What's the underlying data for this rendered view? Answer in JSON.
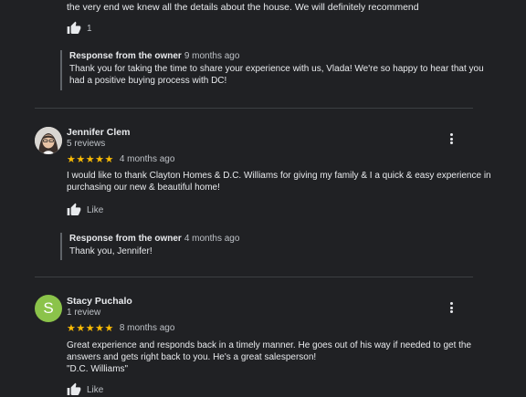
{
  "previous_review": {
    "text_tail": "the very end we knew all the details about the house. We will definitely recommend",
    "like_count": "1",
    "response": {
      "title": "Response from the owner",
      "time": "9 months ago",
      "text": "Thank you for taking the time to share your experience with us, Vlada! We're so happy to hear that you had a positive buying process with DC!"
    }
  },
  "reviews": [
    {
      "name": "Jennifer Clem",
      "review_count": "5 reviews",
      "stars": "★★★★★",
      "rating": 5,
      "time": "4 months ago",
      "text": "I would like to thank Clayton Homes & D.C. Williams for giving my family & I a quick & easy experience in purchasing our new & beautiful home!",
      "like_label": "Like",
      "response": {
        "title": "Response from the owner",
        "time": "4 months ago",
        "text": "Thank you, Jennifer!"
      }
    },
    {
      "name": "Stacy Puchalo",
      "avatar_letter": "S",
      "avatar_color": "#8bc34a",
      "review_count": "1 review",
      "stars": "★★★★★",
      "rating": 5,
      "time": "8 months ago",
      "text_line1": "Great experience and responds back in a timely manner. He goes out of his way if needed to get the answers and gets right back to you. He's a great salesperson!",
      "text_line2": "\"D.C. Williams\"",
      "like_label": "Like"
    }
  ],
  "colors": {
    "background": "#202124",
    "star": "#fbbc04",
    "text_primary": "#e8eaed",
    "text_secondary": "#bdc1c6"
  },
  "icons": [
    "thumbs-up-icon",
    "more-vert-icon"
  ]
}
